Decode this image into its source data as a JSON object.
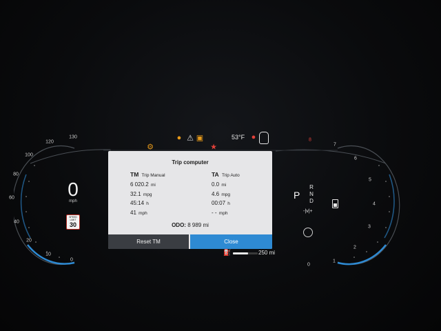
{
  "speedometer": {
    "speed": "0",
    "unit": "mph",
    "ticks": [
      "0",
      "10",
      "20",
      "40",
      "60",
      "80",
      "100",
      "120",
      "130"
    ],
    "speed_limit": {
      "label": "SPEED LIMIT",
      "value": "30"
    }
  },
  "tachometer": {
    "ticks": [
      "0",
      "1",
      "2",
      "3",
      "4",
      "5",
      "6",
      "7",
      "8"
    ]
  },
  "status_bar": {
    "outside_temp": "53°F"
  },
  "trip_computer": {
    "title": "Trip computer",
    "manual": {
      "abbr": "TM",
      "name": "Trip Manual",
      "distance": "6 020.2",
      "distance_unit": "mi",
      "consumption": "32.1",
      "consumption_unit": "mpg",
      "time": "45:14",
      "time_unit": "h",
      "avg_speed": "41",
      "avg_speed_unit": "mph"
    },
    "auto": {
      "abbr": "TA",
      "name": "Trip Auto",
      "distance": "0.0",
      "distance_unit": "mi",
      "consumption": "4.6",
      "consumption_unit": "mpg",
      "time": "00:07",
      "time_unit": "h",
      "avg_speed": "- -",
      "avg_speed_unit": "mph"
    },
    "odo_label": "ODO:",
    "odo_value": "8 989",
    "odo_unit": "mi",
    "reset_label": "Reset TM",
    "close_label": "Close"
  },
  "gear": {
    "active": "P",
    "letters": [
      "R",
      "N",
      "D"
    ],
    "mode": "-|v|+"
  },
  "range": {
    "value": "250",
    "unit": "mi",
    "fuel_level": 0.6
  },
  "colors": {
    "accent_blue": "#2e8ad3",
    "warning_amber": "#e79a1a",
    "warning_red": "#e2413a"
  },
  "icons": [
    "check-engine-icon",
    "turtle-icon",
    "hazard-triangle-icon",
    "oil-warning-icon",
    "airbag-icon",
    "seatbelt-icon",
    "car-door-icon",
    "fuel-pump-icon",
    "battery-icon",
    "eco-mode-icon"
  ]
}
